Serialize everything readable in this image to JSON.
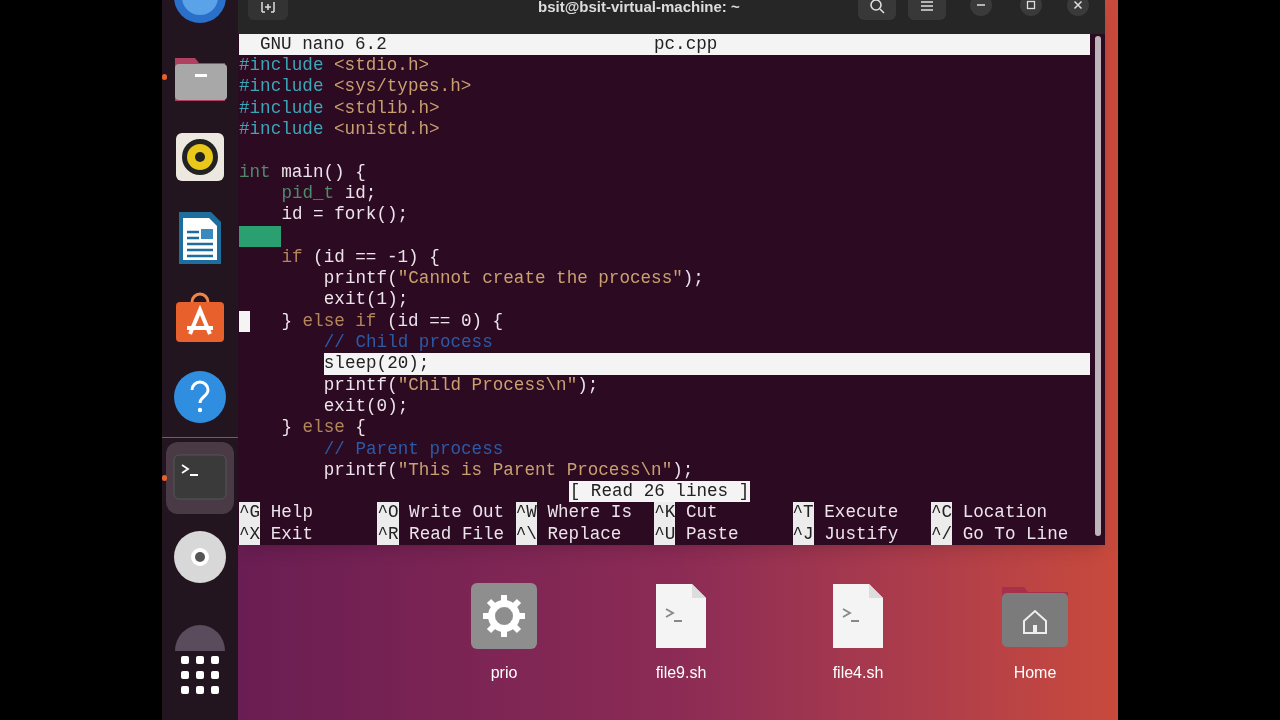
{
  "dock": {
    "items": [
      {
        "kind": "globe",
        "running": false,
        "selected": false
      },
      {
        "kind": "folder",
        "running": true,
        "selected": false
      },
      {
        "kind": "speaker",
        "running": false,
        "selected": false
      },
      {
        "kind": "document",
        "running": false,
        "selected": false
      },
      {
        "kind": "bag",
        "running": false,
        "selected": false
      },
      {
        "kind": "help",
        "running": false,
        "selected": false
      },
      {
        "kind": "terminal",
        "running": true,
        "selected": true
      },
      {
        "kind": "disc",
        "running": false,
        "selected": false
      },
      {
        "kind": "dome",
        "running": false,
        "selected": false
      }
    ]
  },
  "terminal": {
    "title": "bsit@bsit-virtual-machine: ~",
    "nano": {
      "version": "GNU nano 6.2",
      "filename": "pc.cpp",
      "lines": [
        {
          "kind": "code",
          "tokens": [
            {
              "kind": "preproc",
              "text": "#include"
            },
            {
              "kind": "header",
              "text": " <stdio.h>"
            }
          ]
        },
        {
          "kind": "code",
          "tokens": [
            {
              "kind": "preproc",
              "text": "#include"
            },
            {
              "kind": "header",
              "text": " <sys/types.h>"
            }
          ]
        },
        {
          "kind": "code",
          "tokens": [
            {
              "kind": "preproc",
              "text": "#include"
            },
            {
              "kind": "header",
              "text": " <stdlib.h>"
            }
          ]
        },
        {
          "kind": "code",
          "tokens": [
            {
              "kind": "preproc",
              "text": "#include"
            },
            {
              "kind": "header",
              "text": " <unistd.h>"
            }
          ]
        },
        {
          "kind": "blank"
        },
        {
          "kind": "code",
          "tokens": [
            {
              "kind": "type",
              "text": "int"
            },
            {
              "kind": "plain",
              "text": " main() {"
            }
          ],
          "children": [
            {
              "kind": "code",
              "tokens": [
                {
                  "kind": "type",
                  "text": "pid_t"
                },
                {
                  "kind": "plain",
                  "text": " id;"
                }
              ]
            },
            {
              "kind": "code",
              "tokens": [
                {
                  "kind": "plain",
                  "text": "id = fork();"
                }
              ]
            },
            {
              "kind": "whitespace"
            },
            {
              "kind": "code",
              "tokens": [
                {
                  "kind": "keyword",
                  "text": "if"
                },
                {
                  "kind": "plain",
                  "text": " (id == -1) {"
                }
              ],
              "children": [
                {
                  "kind": "code",
                  "tokens": [
                    {
                      "kind": "plain",
                      "text": "printf("
                    },
                    {
                      "kind": "string",
                      "text": "\"Cannot create the process\""
                    },
                    {
                      "kind": "plain",
                      "text": ");"
                    }
                  ]
                },
                {
                  "kind": "code",
                  "tokens": [
                    {
                      "kind": "plain",
                      "text": "exit(1);"
                    }
                  ]
                }
              ]
            },
            {
              "kind": "code",
              "cursor": true,
              "tokens": [
                {
                  "kind": "plain",
                  "text": "} "
                },
                {
                  "kind": "keyword",
                  "text": "else if"
                },
                {
                  "kind": "plain",
                  "text": " (id == 0) {"
                }
              ],
              "children": [
                {
                  "kind": "code",
                  "tokens": [
                    {
                      "kind": "comment",
                      "text": "// Child process"
                    }
                  ]
                },
                {
                  "kind": "code",
                  "tokens": [
                    {
                      "kind": "marked",
                      "text": "sleep(20);"
                    }
                  ]
                },
                {
                  "kind": "code",
                  "tokens": [
                    {
                      "kind": "plain",
                      "text": "printf("
                    },
                    {
                      "kind": "string",
                      "text": "\"Child Process\\n\""
                    },
                    {
                      "kind": "plain",
                      "text": ");"
                    }
                  ]
                },
                {
                  "kind": "code",
                  "tokens": [
                    {
                      "kind": "plain",
                      "text": "exit(0);"
                    }
                  ]
                }
              ]
            },
            {
              "kind": "code",
              "tokens": [
                {
                  "kind": "plain",
                  "text": "} "
                },
                {
                  "kind": "keyword",
                  "text": "else"
                },
                {
                  "kind": "plain",
                  "text": " {"
                }
              ],
              "children": [
                {
                  "kind": "code",
                  "tokens": [
                    {
                      "kind": "comment",
                      "text": "// Parent process"
                    }
                  ]
                },
                {
                  "kind": "code",
                  "tokens": [
                    {
                      "kind": "plain",
                      "text": "printf("
                    },
                    {
                      "kind": "string",
                      "text": "\"This is Parent Process\\n\""
                    },
                    {
                      "kind": "plain",
                      "text": ");"
                    }
                  ]
                }
              ]
            }
          ]
        }
      ],
      "status": "[ Read 26 lines ]",
      "shortcuts": [
        [
          {
            "key": "^G",
            "label": "Help"
          },
          {
            "key": "^O",
            "label": "Write Out"
          },
          {
            "key": "^W",
            "label": "Where Is"
          },
          {
            "key": "^K",
            "label": "Cut"
          },
          {
            "key": "^T",
            "label": "Execute"
          },
          {
            "key": "^C",
            "label": "Location"
          }
        ],
        [
          {
            "key": "^X",
            "label": "Exit"
          },
          {
            "key": "^R",
            "label": "Read File"
          },
          {
            "key": "^\\",
            "label": "Replace"
          },
          {
            "key": "^U",
            "label": "Paste"
          },
          {
            "key": "^J",
            "label": "Justify"
          },
          {
            "key": "^/",
            "label": "Go To Line"
          }
        ]
      ]
    }
  },
  "desktop": {
    "icons": [
      {
        "kind": "executable",
        "label": "prio"
      },
      {
        "kind": "script",
        "label": "file9.sh"
      },
      {
        "kind": "script",
        "label": "file4.sh"
      },
      {
        "kind": "home",
        "label": "Home"
      }
    ]
  }
}
